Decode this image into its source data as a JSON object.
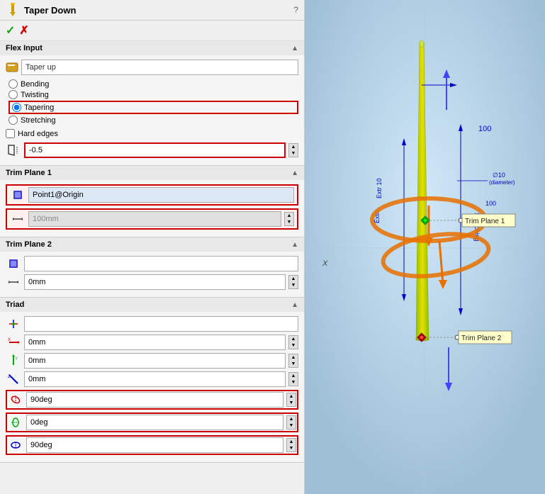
{
  "header": {
    "title": "Taper Down",
    "help_label": "?"
  },
  "toolbar": {
    "confirm_label": "✓",
    "cancel_label": "✗"
  },
  "sections": {
    "flex_input": {
      "label": "Flex Input",
      "text_value": "Taper up",
      "radio_options": [
        "Bending",
        "Twisting",
        "Tapering",
        "Stretching"
      ],
      "selected_radio": "Tapering",
      "hard_edges_label": "Hard edges",
      "taper_value": "-0.5"
    },
    "trim_plane_1": {
      "label": "Trim Plane 1",
      "origin_value": "Point1@Origin",
      "distance_value": "100mm",
      "label_in_view": "Trim Plane 1"
    },
    "trim_plane_2": {
      "label": "Trim Plane 2",
      "origin_value": "",
      "distance_value": "0mm",
      "label_in_view": "Trim Plane 2"
    },
    "triad": {
      "label": "Triad",
      "origin_value": "",
      "x_value": "0mm",
      "y_value": "0mm",
      "z_value": "0mm",
      "rx_value": "90deg",
      "ry_value": "0deg",
      "rz_value": "90deg"
    }
  }
}
